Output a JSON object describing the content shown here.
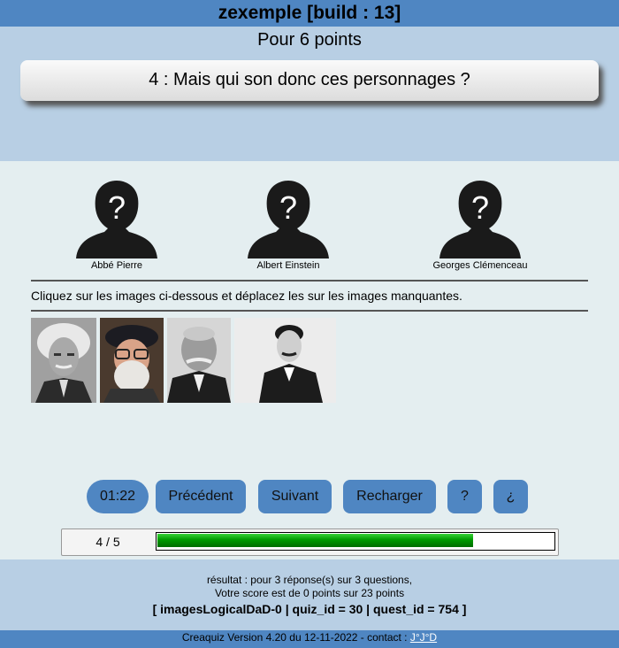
{
  "app": {
    "title": "zexemple [build : 13]"
  },
  "question": {
    "points": "Pour 6 points",
    "text": "4 : Mais qui son donc ces personnages ?"
  },
  "slots": [
    {
      "label": "Abbé Pierre"
    },
    {
      "label": "Albert Einstein"
    },
    {
      "label": "Georges Clémenceau"
    }
  ],
  "instruction": "Cliquez sur les images ci-dessous et déplacez les sur les images manquantes.",
  "buttons": {
    "timer": "01:22",
    "prev": "Précédent",
    "next": "Suivant",
    "reload": "Recharger",
    "help": "?",
    "inverted_help": "¿"
  },
  "progress": {
    "text": "4 / 5",
    "fraction": 0.8
  },
  "result": {
    "line1": "résultat : pour 3 réponse(s) sur 3 questions,",
    "line2": "Votre score est de 0 points sur 23 points",
    "ids": "[ imagesLogicalDaD-0 | quiz_id = 30 | quest_id = 754 ]"
  },
  "footer": {
    "text": "Creaquiz Version 4.20 du 12-11-2022 - contact : ",
    "contact": "J°J°D"
  },
  "colors": {
    "accent": "#4f86c2",
    "header_bg": "#b8cfe4",
    "main_bg": "#e4eef0",
    "progress": "#00a000"
  }
}
